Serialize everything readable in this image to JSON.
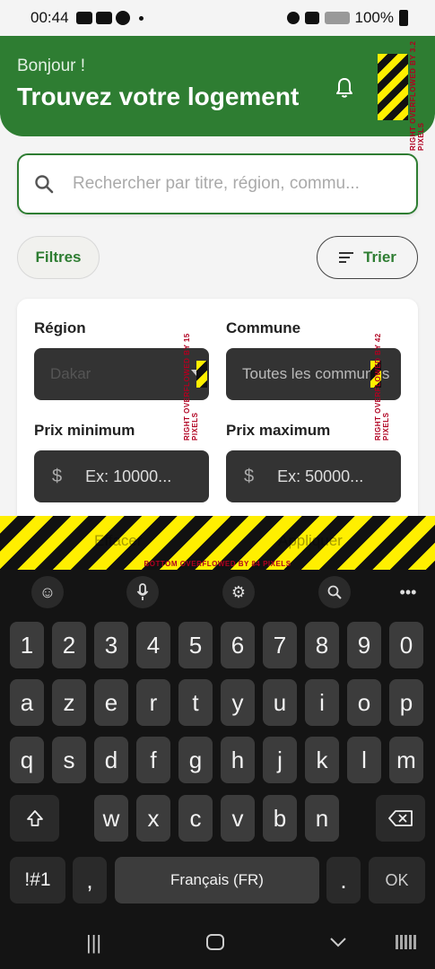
{
  "status_bar": {
    "time": "00:44",
    "battery": "100%"
  },
  "header": {
    "greeting": "Bonjour !",
    "title": "Trouvez votre logement",
    "bg_color": "#2e7d32"
  },
  "search": {
    "placeholder": "Rechercher par titre, région, commu..."
  },
  "chips": {
    "filtres_label": "Filtres",
    "trier_label": "Trier"
  },
  "filters": {
    "region_label": "Région",
    "region_value": "Dakar",
    "commune_label": "Commune",
    "commune_value": "Toutes les communes",
    "prix_min_label": "Prix minimum",
    "prix_min_placeholder": "Ex: 10000...",
    "prix_max_label": "Prix maximum",
    "prix_max_placeholder": "Ex: 50000...",
    "currency_symbol": "$",
    "effacer_label": "Effacer",
    "appliquer_label": "Appliquer"
  },
  "overflow_warnings": {
    "header_right": "RIGHT OVERFLOWED BY 3.2 PIXELS",
    "region_right": "RIGHT OVERFLOWED BY 15 PIXELS",
    "commune_right": "RIGHT OVERFLOWED BY 42 PIXELS",
    "bottom": "BOTTOM OVERFLOWED BY 84 PIXELS"
  },
  "keyboard": {
    "numbers": [
      "1",
      "2",
      "3",
      "4",
      "5",
      "6",
      "7",
      "8",
      "9",
      "0"
    ],
    "row1": [
      "a",
      "z",
      "e",
      "r",
      "t",
      "y",
      "u",
      "i",
      "o",
      "p"
    ],
    "row2": [
      "q",
      "s",
      "d",
      "f",
      "g",
      "h",
      "j",
      "k",
      "l",
      "m"
    ],
    "row3": [
      "w",
      "x",
      "c",
      "v",
      "b",
      "n"
    ],
    "symbols_key": "!#1",
    "comma_key": ",",
    "space_label": "Français (FR)",
    "period_key": ".",
    "ok_key": "OK"
  }
}
